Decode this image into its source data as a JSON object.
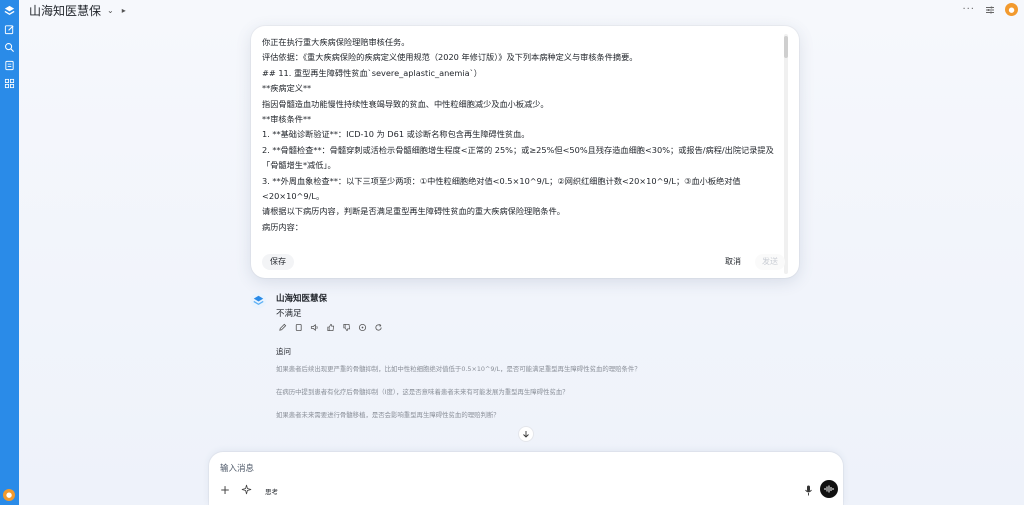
{
  "header": {
    "app_title": "山海知医慧保"
  },
  "sidebar": {
    "items": [
      {
        "icon": "edit-icon"
      },
      {
        "icon": "search-icon"
      },
      {
        "icon": "library-icon"
      },
      {
        "icon": "apps-icon"
      }
    ]
  },
  "edit_card": {
    "lines": [
      "你正在执行重大疾病保险理赔审核任务。",
      "评估依据：《重大疾病保险的疾病定义使用规范（2020 年修订版）》及下列本病种定义与审核条件摘要。",
      "## 11. 重型再生障碍性贫血`severe_aplastic_anemia`）",
      "**疾病定义**",
      "指因骨髓造血功能慢性持续性衰竭导致的贫血、中性粒细胞减少及血小板减少。",
      "**审核条件**",
      "1. **基础诊断验证**：ICD-10 为 D61 或诊断名称包含再生障碍性贫血。",
      "2. **骨髓检查**：骨髓穿刺或活检示骨髓细胞增生程度<正常的 25%；或≥25%但<50%且残存造血细胞<30%；或报告/病程/出院记录提及「骨髓增生*减低」。",
      "3. **外周血象检查**：以下三项至少两项：①中性粒细胞绝对值<0.5×10^9/L；②网织红细胞计数<20×10^9/L；③血小板绝对值<20×10^9/L。",
      "",
      "请根据以下病历内容，判断是否满足重型再生障碍性贫血的重大疾病保险理赔条件。",
      "病历内容："
    ],
    "save_label": "保存",
    "cancel_label": "取消",
    "send_label": "发送"
  },
  "assistant": {
    "name": "山海知医慧保",
    "answer": "不满足",
    "action_icons": [
      "edit-icon",
      "copy-icon",
      "read-aloud-icon",
      "thumbs-up-icon",
      "thumbs-down-icon",
      "share-icon",
      "regenerate-icon"
    ]
  },
  "followups": {
    "title": "追问",
    "items": [
      "如果患者后续出现更严重的骨髓抑制，比如中性粒细胞绝对值低于0.5×10^9/L，是否可能满足重型再生障碍性贫血的理赔条件？",
      "在病历中提到患者有化疗后骨髓抑制（I度），这是否意味着患者未来有可能发展为重型再生障碍性贫血？",
      "如果患者未来需要进行骨髓移植，是否会影响重型再生障碍性贫血的理赔判断？"
    ]
  },
  "composer": {
    "placeholder": "输入消息",
    "think_label": "思考"
  },
  "colors": {
    "rail": "#2a8be8",
    "avatar": "#f29a2e"
  }
}
